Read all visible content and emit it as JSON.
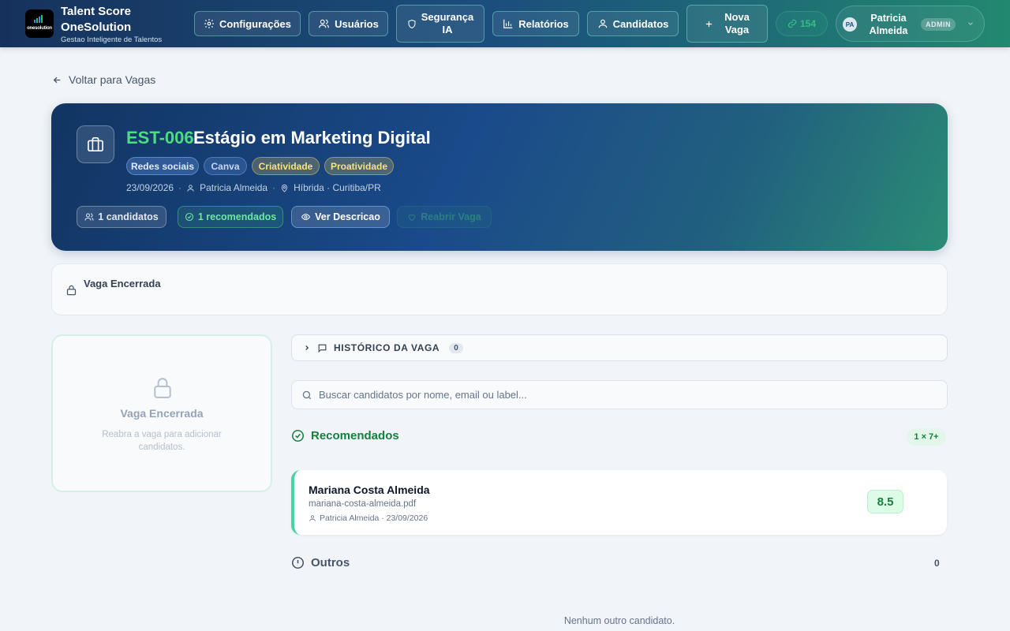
{
  "header": {
    "logo_text": "onesolution",
    "brand_line1": "Talent Score",
    "brand_line2": "OneSolution",
    "tagline": "Gestao Inteligente de Talentos",
    "nav": {
      "settings": "Configurações",
      "users": "Usuários",
      "security_1": "Segurança",
      "security_2": "IA",
      "reports": "Relatórios",
      "candidates": "Candidatos",
      "new_job_1": "Nova",
      "new_job_2": "Vaga"
    },
    "credits": "154",
    "user": {
      "initials": "PA",
      "name_1": "Patricia",
      "name_2": "Almeida",
      "role": "ADMIN"
    }
  },
  "back_link": "Voltar para Vagas",
  "job": {
    "code": "EST-006",
    "title": "Estágio em Marketing Digital",
    "tags": [
      "Redes sociais",
      "Canva",
      "Criatividade",
      "Proatividade"
    ],
    "date": "23/09/2026",
    "owner": "Patricia Almeida",
    "location": "Híbrida · Curitiba/PR",
    "candidates_label": "1 candidatos",
    "recommended_label": "1 recomendados",
    "view_description": "Ver Descricao",
    "reopen": "Reabrir Vaga"
  },
  "closed_notice": "Vaga Encerrada",
  "left_panel": {
    "title": "Vaga Encerrada",
    "subtitle": "Reabra a vaga para adicionar candidatos."
  },
  "history": {
    "label": "HISTÓRICO DA VAGA",
    "count": "0"
  },
  "search": {
    "placeholder": "Buscar candidatos por nome, email ou label..."
  },
  "recommended": {
    "title": "Recomendados",
    "badge": "1 × 7+",
    "candidates": [
      {
        "name": "Mariana Costa Almeida",
        "file": "mariana-costa-almeida.pdf",
        "meta": "Patricia Almeida · 23/09/2026",
        "score": "8.5"
      }
    ]
  },
  "others": {
    "title": "Outros",
    "count": "0",
    "empty": "Nenhum outro candidato."
  },
  "colors": {
    "brand_green": "#4ade80",
    "recommended": "#15803d",
    "accent_border": "#4ad3a0"
  }
}
